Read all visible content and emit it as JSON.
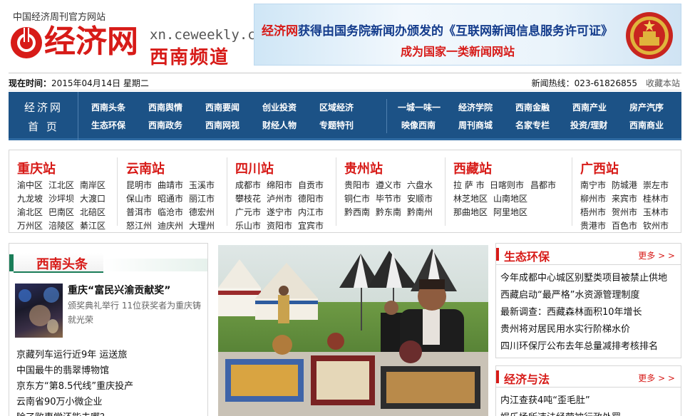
{
  "header": {
    "tagline": "中国经济周刊官方网站",
    "logo_text": "经济网",
    "domain": "xn.ceweekly.cn",
    "channel": "西南频道",
    "banner": {
      "brand": "经济网",
      "line1_rest": "获得由国务院新闻办颁发的《互联网新闻信息服务许可证》",
      "line2": "成为国家一类新闻网站"
    }
  },
  "infobar": {
    "date_label": "现在时间：",
    "date_value": "2015年04月14日 星期二",
    "hotline": "新闻热线：023-61826855",
    "bookmark": "收藏本站"
  },
  "nav": {
    "home_line1": "经济网",
    "home_line2": "首 页",
    "row1_left": [
      "西南头条",
      "西南舆情",
      "西南要闻",
      "创业投资",
      "区域经济"
    ],
    "row2_left": [
      "生态环保",
      "西南政务",
      "西南网视",
      "财经人物",
      "专题特刊"
    ],
    "row1_right": [
      "一城一味一",
      "经济学院",
      "西南金融",
      "西南产业",
      "房产汽序"
    ],
    "row2_right": [
      "映像西南",
      "周刊商城",
      "名家专栏",
      "投资/理财",
      "西南商业"
    ]
  },
  "stations": [
    {
      "title": "重庆站",
      "cities": [
        "渝中区",
        "江北区",
        "南岸区",
        "九龙坡",
        "沙坪坝",
        "大渡口",
        "渝北区",
        "巴南区",
        "北碚区",
        "万州区",
        "涪陵区",
        "綦江区"
      ]
    },
    {
      "title": "云南站",
      "cities": [
        "昆明市",
        "曲靖市",
        "玉溪市",
        "保山市",
        "昭通市",
        "丽江市",
        "普洱市",
        "临沧市",
        "德宏州",
        "怒江州",
        "迪庆州",
        "大理州"
      ]
    },
    {
      "title": "四川站",
      "cities": [
        "成都市",
        "绵阳市",
        "自贡市",
        "攀枝花",
        "泸州市",
        "德阳市",
        "广元市",
        "遂宁市",
        "内江市",
        "乐山市",
        "资阳市",
        "宜宾市"
      ]
    },
    {
      "title": "贵州站",
      "cities": [
        "贵阳市",
        "遵义市",
        "六盘水",
        "铜仁市",
        "毕节市",
        "安顺市",
        "黔西南",
        "黔东南",
        "黔南州"
      ]
    },
    {
      "title": "西藏站",
      "cities": [
        "拉 萨 市",
        "日喀则市",
        "昌都市",
        "林芝地区",
        "山南地区",
        "那曲地区",
        "阿里地区"
      ]
    },
    {
      "title": "广西站",
      "cities": [
        "南宁市",
        "防城港",
        "崇左市",
        "柳州市",
        "来宾市",
        "桂林市",
        "梧州市",
        "贺州市",
        "玉林市",
        "贵港市",
        "百色市",
        "钦州市"
      ]
    }
  ],
  "headlines": {
    "title": "西南头条",
    "feature_title": "重庆“富民兴渝贡献奖”",
    "feature_desc": "颁奖典礼举行 11位获奖者为重庆铸就光荣",
    "items": [
      "京藏列车运行近9年 运送旅",
      "中国最牛的翡翠博物馆",
      "京东方“第8.5代线”重庆投产",
      "云南省90万小微企业",
      "除了败惠堂还能去哪？"
    ]
  },
  "eco": {
    "title": "生态环保",
    "more": "更多 > >",
    "items": [
      "今年成都中心城区别墅类项目被禁止供地",
      "西藏启动“最严格”水资源管理制度",
      "最新调查：西藏森林面积10年增长",
      "贵州将对居民用水实行阶梯水价",
      "四川环保厅公布去年总量减排考核排名"
    ]
  },
  "law": {
    "title": "经济与法",
    "more": "更多 > >",
    "items": [
      "内江查获4吨“歪毛肚”",
      "娱乐场所违法经营被行政处罚"
    ]
  }
}
